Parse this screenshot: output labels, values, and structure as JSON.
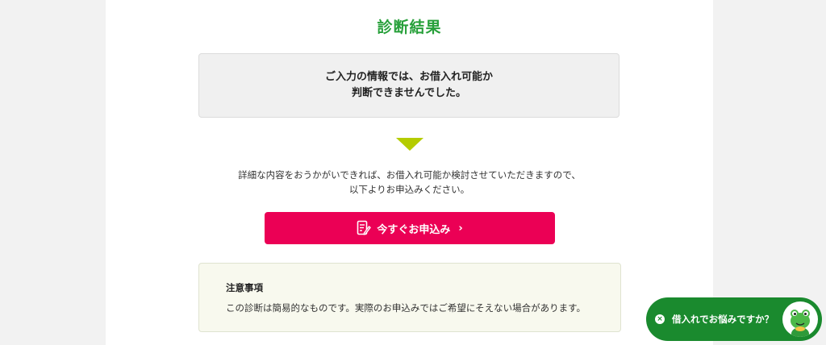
{
  "page": {
    "title": "診断結果"
  },
  "result": {
    "line1": "ご入力の情報では、お借入れ可能か",
    "line2": "判断できませんでした。"
  },
  "description": {
    "line1": "詳細な内容をおうかがいできれば、お借入れ可能か検討させていただきますので、",
    "line2": "以下よりお申込みください。"
  },
  "apply_button": {
    "label": "今すぐお申込み",
    "chevron": "›",
    "icon": "form-edit-icon"
  },
  "notice": {
    "title": "注意事項",
    "text": "この診断は簡易的なものです。実際のお申込みではご希望にそえない場合があります。"
  },
  "chat_widget": {
    "label": "借入れでお悩みですか？",
    "close_glyph": "×",
    "avatar": "frog-mascot-icon"
  },
  "colors": {
    "title_green": "#27a03a",
    "arrow_lime": "#b5cc00",
    "button_pink": "#eb0055",
    "chat_green": "#1a8a2e"
  }
}
